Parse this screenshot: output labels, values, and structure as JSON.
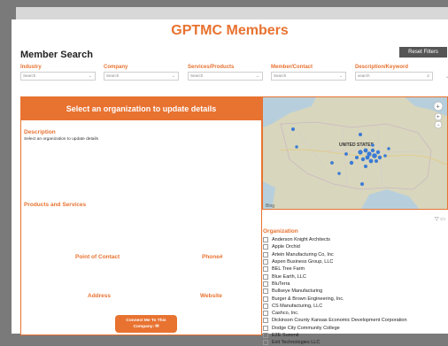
{
  "report": {
    "title": "GPTMC Members"
  },
  "search": {
    "title": "Member Search",
    "reset_label": "Reset Filters",
    "filters": [
      {
        "label": "Industry",
        "value": "Search"
      },
      {
        "label": "Company",
        "value": "Search"
      },
      {
        "label": "Services/Products",
        "value": "Search"
      },
      {
        "label": "Member/Contact",
        "value": "Search"
      },
      {
        "label": "Description/Keyword",
        "value": "search"
      }
    ]
  },
  "details": {
    "header": "Select an organization to update details",
    "description_label": "Description",
    "description_text": "Select an organization to update details",
    "products_label": "Products and Services",
    "contact_label": "Point of Contact",
    "phone_label": "Phone#",
    "address_label": "Address",
    "website_label": "Website",
    "connect_line1": "Connect Me To This",
    "connect_line2": "Company: ✉"
  },
  "map": {
    "country_label": "UNITED STATES",
    "bing_label": "Bing"
  },
  "organizations": {
    "title": "Organization",
    "items": [
      "Anderson Knight Architects",
      "Apple Orchid",
      "Artein Manufacturing Co, Inc",
      "Aspen Business Group, LLC",
      "BEL Tree Farm",
      "Blue Earth, LLC",
      "BluTerra",
      "Bullseye Manufacturing",
      "Burger & Brown Engineering, Inc.",
      "CS Manufacturing, LLC",
      "Cashco, Inc.",
      "Dickinson County Kansas Economic Development Corporation",
      "Dodge City Community College",
      "E2E Summit",
      "Exit Technologies LLC"
    ]
  },
  "colors": {
    "accent": "#e87230",
    "dot": "#3a7bd5"
  }
}
